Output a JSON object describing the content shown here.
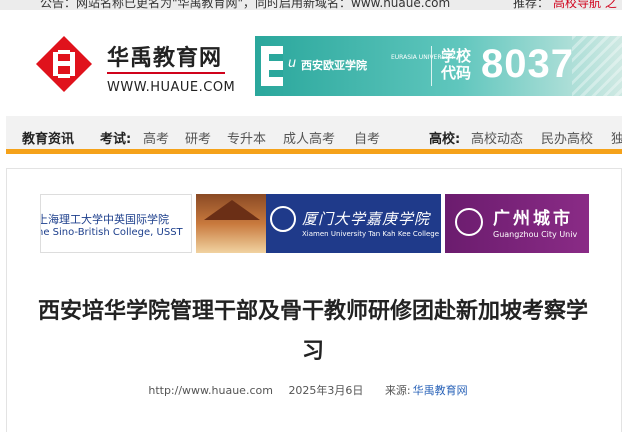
{
  "topstrip": {
    "notice": "公告：网站名称已更名为\"华禹教育网\"，同时启用新域名：www.huaue.com",
    "rec_label": "推荐：",
    "rec_link": "高校导航 之"
  },
  "header": {
    "logo_cn": "华禹教育网",
    "logo_url": "WWW.HUAUE.COM",
    "ad": {
      "eu": "u",
      "school": "西安欧亚学院",
      "school_en": "EURASIA UNIVERSITY",
      "code_label": "学校代码",
      "code": "8037"
    }
  },
  "nav": {
    "news": "教育资讯",
    "exam_label": "考试:",
    "exam_links": [
      "高考",
      "研考",
      "专升本",
      "成人高考",
      "自考"
    ],
    "uni_label": "高校:",
    "uni_links": [
      "高校动态",
      "民办高校",
      "独"
    ]
  },
  "ads": {
    "ad1_line1": "上海理工大学中英国际学院",
    "ad1_line2": "ne Sino-British College, USST",
    "ad2_cn": "厦门大学嘉庚学院",
    "ad2_en": "Xiamen University Tan Kah Kee College",
    "ad3_cn": "广州城市",
    "ad3_en": "Guangzhou City Univ"
  },
  "article": {
    "title": "西安培华学院管理干部及骨干教师研修团赴新加坡考察学习",
    "url": "http://www.huaue.com",
    "date": "2025年3月6日",
    "source_label": "来源:",
    "source": "华禹教育网"
  }
}
